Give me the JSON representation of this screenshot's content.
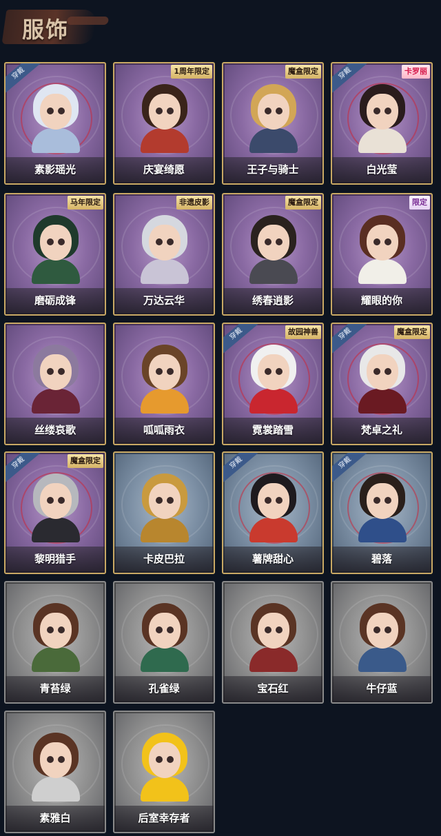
{
  "header": {
    "title": "服饰"
  },
  "colors": {
    "purple_tier": "#8a6aa3",
    "blue_tier": "#7b8ea3",
    "gray_tier": "#8e8e8e",
    "frame_gold": "#c9a964"
  },
  "costumes": [
    {
      "name": "素影瑶光",
      "tier": "purple",
      "worn": "穿戴",
      "tag": "",
      "hair": "#dfe6f2",
      "outfit": "#a9bddb"
    },
    {
      "name": "庆宴绮愿",
      "tier": "purple",
      "worn": "",
      "tag": "1周年限定",
      "hair": "#3a241a",
      "outfit": "#b33b2e"
    },
    {
      "name": "王子与骑士",
      "tier": "purple",
      "worn": "",
      "tag": "魔盒限定",
      "hair": "#d2a656",
      "outfit": "#3b4a6b"
    },
    {
      "name": "白光莹",
      "tier": "purple",
      "worn": "穿戴",
      "tag": "卡罗丽",
      "tag_style": "pink",
      "hair": "#2a1c1c",
      "outfit": "#e9e1d6"
    },
    {
      "name": "磨砺成锋",
      "tier": "purple",
      "worn": "",
      "tag": "马年限定",
      "hair": "#1f3a2c",
      "outfit": "#2f5a3f"
    },
    {
      "name": "万达云华",
      "tier": "purple",
      "worn": "",
      "tag": "非遗皮影",
      "hair": "#d5d8df",
      "outfit": "#c9c4d6"
    },
    {
      "name": "绣春逍影",
      "tier": "purple",
      "worn": "",
      "tag": "魔盒限定",
      "hair": "#2a221e",
      "outfit": "#4a4a52"
    },
    {
      "name": "耀眼的你",
      "tier": "purple",
      "worn": "",
      "tag": "限定",
      "tag_style": "lilac",
      "hair": "#5a2e22",
      "outfit": "#f1efe8"
    },
    {
      "name": "丝缕哀歌",
      "tier": "purple",
      "worn": "",
      "tag": "",
      "hair": "#8c7a9e",
      "outfit": "#6a2436"
    },
    {
      "name": "呱呱雨衣",
      "tier": "purple",
      "worn": "",
      "tag": "",
      "hair": "#6a4428",
      "outfit": "#e69a2e"
    },
    {
      "name": "霓裳踏雪",
      "tier": "purple",
      "worn": "穿戴",
      "tag": "故园神兽",
      "hair": "#f0f0f0",
      "outfit": "#c9262f"
    },
    {
      "name": "梵卓之礼",
      "tier": "purple",
      "worn": "穿戴",
      "tag": "魔盒限定",
      "hair": "#e8e8e8",
      "outfit": "#6a1a22"
    },
    {
      "name": "黎明猎手",
      "tier": "purple",
      "worn": "穿戴",
      "tag": "魔盒限定",
      "hair": "#b6b8bd",
      "outfit": "#2a2a30"
    },
    {
      "name": "卡皮巴拉",
      "tier": "blue",
      "worn": "",
      "tag": "",
      "hair": "#c99a3e",
      "outfit": "#b8862e"
    },
    {
      "name": "薯牌甜心",
      "tier": "blue",
      "worn": "穿戴",
      "tag": "",
      "hair": "#1e1a1e",
      "outfit": "#c93a2e"
    },
    {
      "name": "碧落",
      "tier": "blue",
      "worn": "穿戴",
      "tag": "",
      "hair": "#2a1f1a",
      "outfit": "#2f4f8a"
    },
    {
      "name": "青苔绿",
      "tier": "gray",
      "worn": "",
      "tag": "",
      "hair": "#5a3424",
      "outfit": "#4a6a3a"
    },
    {
      "name": "孔雀绿",
      "tier": "gray",
      "worn": "",
      "tag": "",
      "hair": "#5a3424",
      "outfit": "#2f6a4e"
    },
    {
      "name": "宝石红",
      "tier": "gray",
      "worn": "",
      "tag": "",
      "hair": "#5a3424",
      "outfit": "#8a2a2a"
    },
    {
      "name": "牛仔蓝",
      "tier": "gray",
      "worn": "",
      "tag": "",
      "hair": "#5a3424",
      "outfit": "#3a5a8a"
    },
    {
      "name": "素雅白",
      "tier": "gray",
      "worn": "",
      "tag": "",
      "hair": "#5a3424",
      "outfit": "#cfcfcf"
    },
    {
      "name": "后室幸存者",
      "tier": "gray",
      "worn": "",
      "tag": "",
      "hair": "#f2c21a",
      "outfit": "#f2c21a"
    }
  ]
}
